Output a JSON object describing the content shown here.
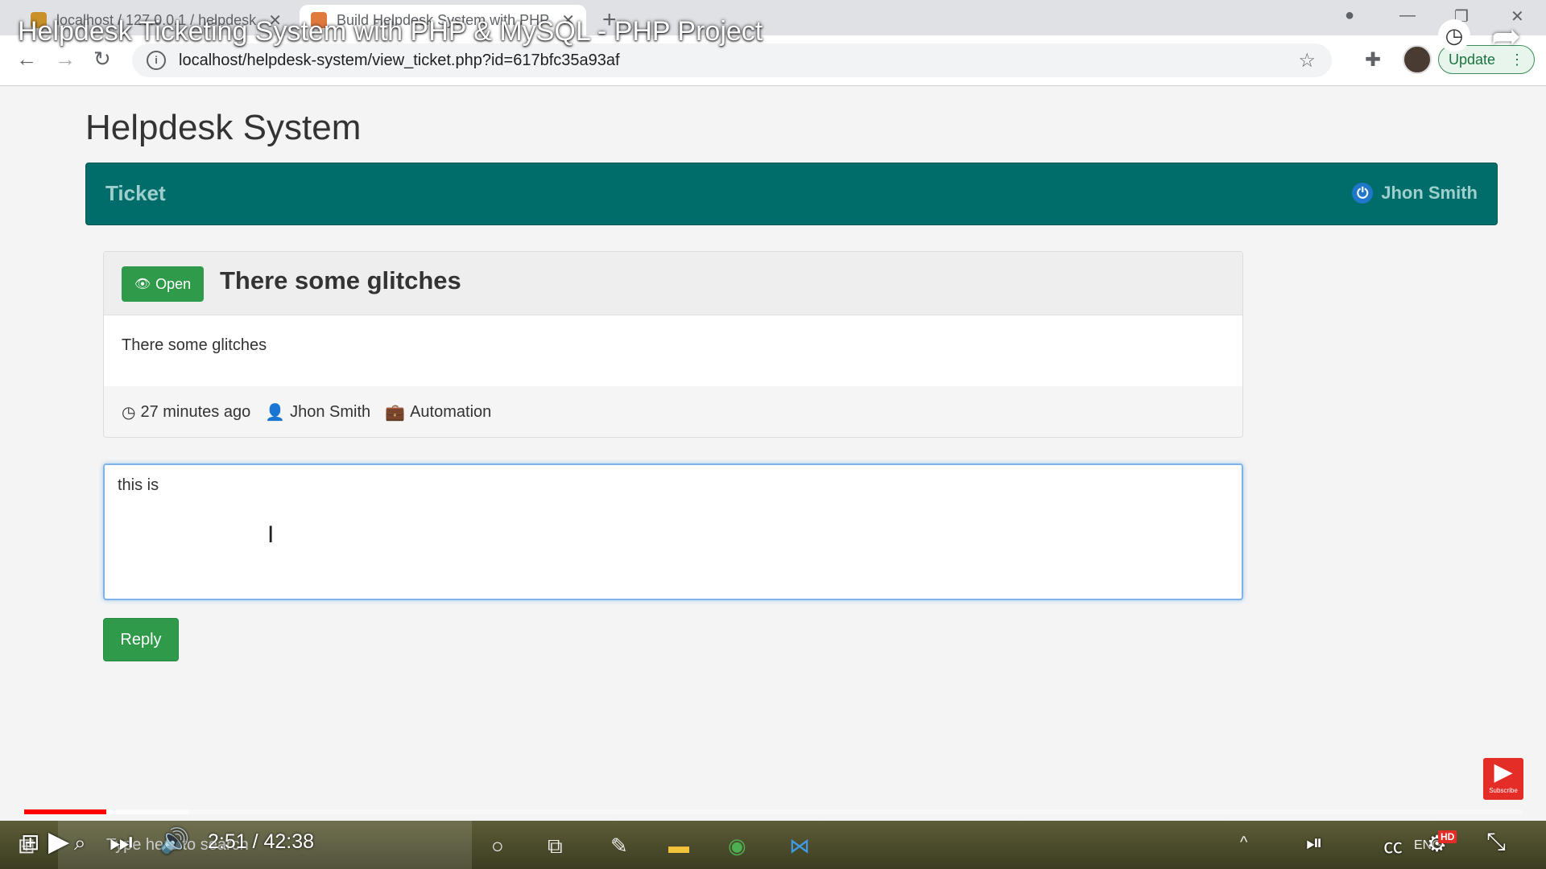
{
  "browser": {
    "tabs": [
      {
        "label": "localhost / 127.0.0.1 / helpdesk",
        "favicon_color": "#c8912a"
      },
      {
        "label": "Build Helpdesk System with PHP",
        "favicon_color": "#e07a3c"
      }
    ],
    "new_tab": "+",
    "url": "localhost/helpdesk-system/view_ticket.php?id=617bfc35a93af",
    "update_label": "Update"
  },
  "video": {
    "title": "Helpdesk Ticketing System with PHP & MySQL - PHP Project",
    "time": "2:51 / 42:38",
    "progress_played": 0.055,
    "progress_buffered": 0.11,
    "subscribe_label": "Subscribe",
    "hd_badge": "HD",
    "accent_color": "#ff0000"
  },
  "page": {
    "app_title": "Helpdesk System",
    "navbar": {
      "brand": "Ticket",
      "user": "Jhon Smith",
      "color": "#006d6b"
    },
    "ticket": {
      "status": "Open",
      "title": "There some glitches",
      "message": "There some glitches",
      "time_ago": "27 minutes ago",
      "author": "Jhon Smith",
      "department": "Automation"
    },
    "reply": {
      "text": "this is ",
      "button": "Reply"
    }
  },
  "taskbar": {
    "search_placeholder": "Type here to search",
    "lang": "ENG"
  }
}
